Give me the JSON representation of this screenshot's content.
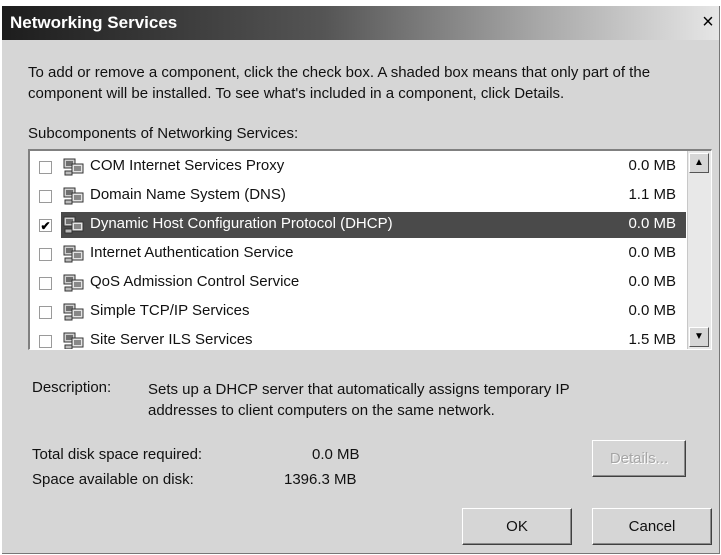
{
  "dialog": {
    "title": "Networking Services",
    "close_glyph": "×",
    "instructions": "To add or remove a component, click the check box. A shaded box means that only part of the component will be installed. To see what's included in a component, click Details.",
    "subcomponents_label": "Subcomponents of Networking Services:"
  },
  "components": [
    {
      "name": "COM Internet Services Proxy",
      "size": "0.0 MB",
      "checked": false,
      "selected": false
    },
    {
      "name": "Domain Name System (DNS)",
      "size": "1.1 MB",
      "checked": false,
      "selected": false
    },
    {
      "name": "Dynamic Host Configuration Protocol (DHCP)",
      "size": "0.0 MB",
      "checked": true,
      "selected": true
    },
    {
      "name": "Internet Authentication Service",
      "size": "0.0 MB",
      "checked": false,
      "selected": false
    },
    {
      "name": "QoS Admission Control Service",
      "size": "0.0 MB",
      "checked": false,
      "selected": false
    },
    {
      "name": "Simple TCP/IP Services",
      "size": "0.0 MB",
      "checked": false,
      "selected": false
    },
    {
      "name": "Site Server ILS Services",
      "size": "1.5 MB",
      "checked": false,
      "selected": false
    }
  ],
  "scrollbar": {
    "up_glyph": "▲",
    "down_glyph": "▼"
  },
  "description": {
    "label": "Description:",
    "text": "Sets up a DHCP server that automatically assigns temporary IP addresses to client computers on the same network."
  },
  "disk": {
    "required_label": "Total disk space required:",
    "required_value": "0.0 MB",
    "available_label": "Space available on disk:",
    "available_value": "1396.3 MB"
  },
  "buttons": {
    "details": "Details...",
    "ok": "OK",
    "cancel": "Cancel"
  },
  "icons": {
    "component": "computer-network-icon",
    "check": "✔"
  },
  "colors": {
    "selection": "#4a4a4a",
    "dialog_bg": "#d6d6d6"
  }
}
